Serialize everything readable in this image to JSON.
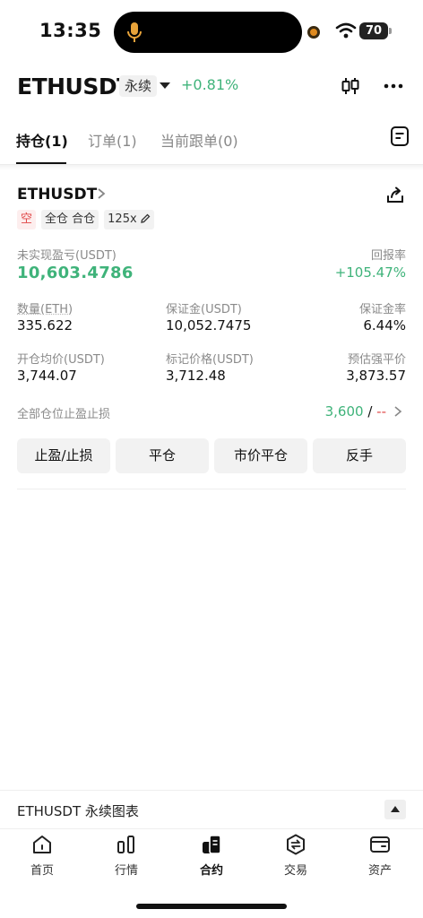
{
  "status": {
    "time": "13:35",
    "battery": "70"
  },
  "header": {
    "pair": "ETHUSDT",
    "contract_type": "永续",
    "change": "+0.81%"
  },
  "tabs": [
    {
      "label": "持仓(1)",
      "active": true
    },
    {
      "label": "订单(1)",
      "active": false
    },
    {
      "label": "当前跟单(0)",
      "active": false
    }
  ],
  "position": {
    "symbol": "ETHUSDT",
    "tags": {
      "side": "空",
      "margin_mode": "全仓 合仓",
      "leverage": "125x"
    },
    "unrealized_pnl_label": "未实现盈亏(USDT)",
    "unrealized_pnl": "10,603.4786",
    "roe_label": "回报率",
    "roe": "+105.47%",
    "qty_label": "数量(ETH)",
    "qty": "335.622",
    "margin_label": "保证金(USDT)",
    "margin": "10,052.7475",
    "margin_ratio_label": "保证金率",
    "margin_ratio": "6.44%",
    "entry_label": "开仓均价(USDT)",
    "entry": "3,744.07",
    "mark_label": "标记价格(USDT)",
    "mark": "3,712.48",
    "liq_label": "预估强平价",
    "liq": "3,873.57",
    "tpsl_label": "全部仓位止盈止损",
    "tp_value": "3,600",
    "tpsl_sep": " / ",
    "sl_value": "--",
    "buttons": [
      "止盈/止损",
      "平仓",
      "市价平仓",
      "反手"
    ]
  },
  "chart_strip": {
    "label": "ETHUSDT 永续图表"
  },
  "bottom_nav": [
    {
      "label": "首页",
      "icon": "home-icon"
    },
    {
      "label": "行情",
      "icon": "market-icon"
    },
    {
      "label": "合约",
      "icon": "futures-icon",
      "active": true
    },
    {
      "label": "交易",
      "icon": "trade-icon"
    },
    {
      "label": "资产",
      "icon": "wallet-icon"
    }
  ],
  "colors": {
    "up": "#3fb37a",
    "down": "#e04848",
    "text": "#111111",
    "muted": "#8a8a8a"
  }
}
